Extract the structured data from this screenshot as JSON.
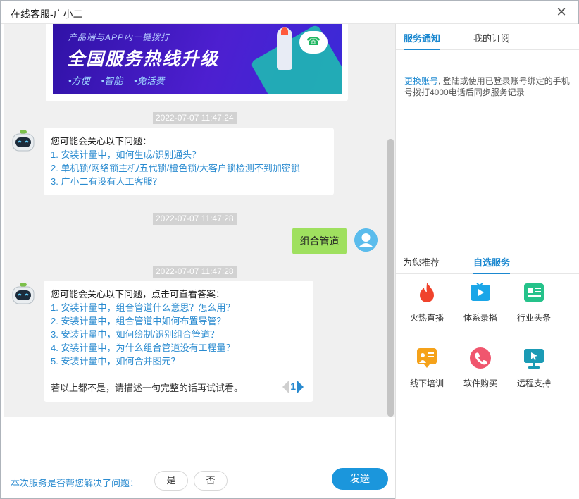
{
  "window": {
    "title": "在线客服-广小二",
    "close_glyph": "✕"
  },
  "banner": {
    "subtitle": "产品端与APP内一键拨打",
    "headline": "全国服务热线升级",
    "tags": [
      "•方便",
      "•智能",
      "•免话费"
    ]
  },
  "messages": {
    "ts1": "2022-07-07 11:47:24",
    "bot1": {
      "intro": "您可能会关心以下问题：",
      "links": [
        "1. 安装计量中，如何生成/识别通头？",
        "2. 单机锁/网络锁主机/五代锁/橙色锁/大客户锁检测不到加密锁",
        "3. 广小二有没有人工客服？"
      ]
    },
    "ts2": "2022-07-07 11:47:28",
    "user": "组合管道",
    "ts3": "2022-07-07 11:47:28",
    "bot2": {
      "intro": "您可能会关心以下问题，点击可直看答案：",
      "links": [
        "1. 安装计量中，组合管道什么意思？怎么用？",
        "2. 安装计量中，组合管道中如何布置导管？",
        "3. 安装计量中，如何绘制/识别组合管道？",
        "4. 安装计量中，为什么组合管道没有工程量？",
        "5. 安装计量中，如何合并图元？"
      ],
      "footer": "若以上都不是，请描述一句完整的话再试试看。",
      "page": "1"
    }
  },
  "input": {
    "feedback_question": "本次服务是否帮您解决了问题：",
    "yes": "是",
    "no": "否",
    "send": "发送"
  },
  "side": {
    "tabs_top": [
      "服务通知",
      "我的订阅"
    ],
    "notice_link": "更换账号",
    "notice_text": ", 登陆或使用已登录账号绑定的手机号拨打4000电话后同步服务记录",
    "tabs_bottom": [
      "为您推荐",
      "自选服务"
    ],
    "services": [
      {
        "label": "火热直播",
        "icon": "flame-icon",
        "color": "#f0432c"
      },
      {
        "label": "体系录播",
        "icon": "play-icon",
        "color": "#1aa6e8"
      },
      {
        "label": "行业头条",
        "icon": "news-icon",
        "color": "#25c28a"
      },
      {
        "label": "线下培训",
        "icon": "training-icon",
        "color": "#f5a21a"
      },
      {
        "label": "软件购买",
        "icon": "phone-icon",
        "color": "#f0566e"
      },
      {
        "label": "远程支持",
        "icon": "remote-support-icon",
        "color": "#1b9bb5"
      }
    ]
  },
  "colors": {
    "accent": "#1b88d0",
    "link": "#2a8bd0",
    "user_bubble": "#9fe05f",
    "send": "#1b96dc"
  }
}
